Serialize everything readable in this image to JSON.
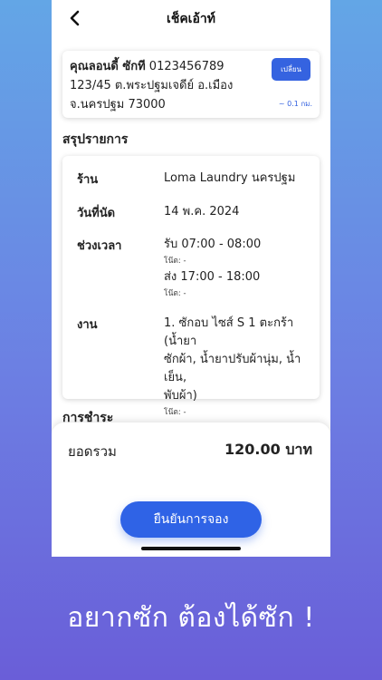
{
  "header": {
    "title": "เช็คเอ้าท์",
    "back_icon": "chevron-left-icon"
  },
  "address": {
    "name": "คุณลอนดี้ ซักที",
    "phone": "0123456789",
    "line1": "123/45 ต.พระปฐมเจดีย์ อ.เมือง",
    "line2": "จ.นครปฐม 73000",
    "change_label": "เปลี่ยน",
    "distance": "~ 0.1 กม."
  },
  "summary": {
    "title": "สรุปรายการ",
    "shop_label": "ร้าน",
    "shop_value": "Loma Laundry นครปฐม",
    "date_label": "วันที่นัด",
    "date_value": "14 พ.ค. 2024",
    "time_label": "ช่วงเวลา",
    "pickup": "รับ 07:00 - 08:00",
    "pickup_note": "โน๊ต: -",
    "delivery": "ส่ง 17:00 - 18:00",
    "delivery_note": "โน๊ต: -",
    "job_label": "งาน",
    "job_line1": "1. ซักอบ ไซส์ S 1 ตะกร้า (น้ำยา",
    "job_line2": "ซักผ้า, น้ำยาปรับผ้านุ่ม, น้ำเย็น,",
    "job_line3": "พับผ้า)",
    "job_note": "โน๊ต: -"
  },
  "payment": {
    "title": "การชำระ"
  },
  "checkout": {
    "total_label": "ยอดรวม",
    "total_value": "120.00 บาท",
    "confirm_label": "ยืนยันการจอง"
  },
  "tagline": "อยากซัก ต้องได้ซัก !",
  "colors": {
    "accent": "#2f63e6",
    "background_top": "#63a6e6",
    "background_bottom": "#6a5ed8"
  }
}
